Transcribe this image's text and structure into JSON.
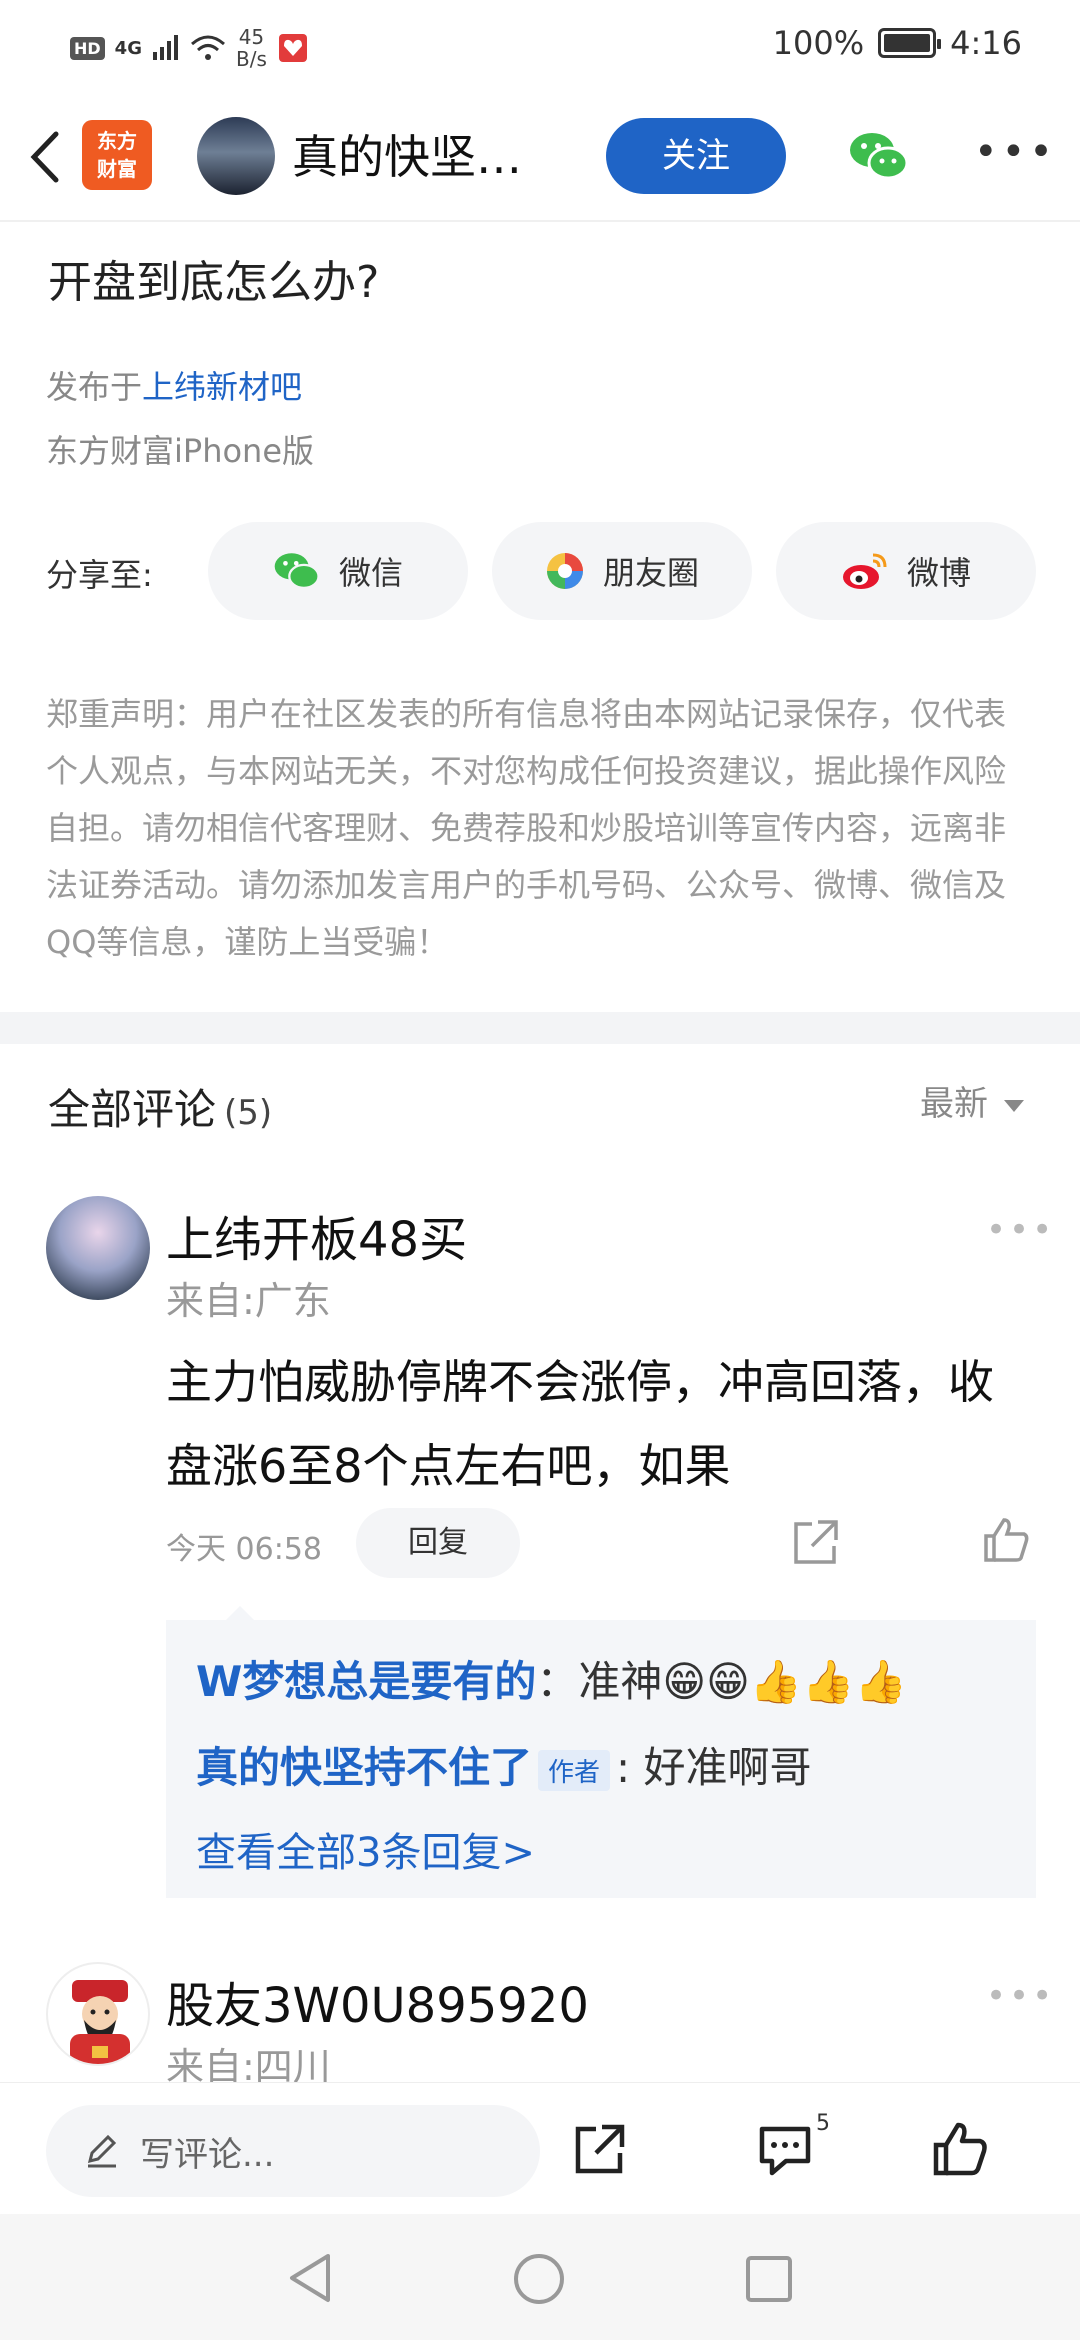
{
  "status_bar": {
    "hd": "HD",
    "signal": "4G",
    "rate_value": "45",
    "rate_unit": "B/s",
    "battery": "100%",
    "time": "4:16"
  },
  "nav": {
    "app_logo_line1": "东方",
    "app_logo_line2": "财富",
    "title": "真的快坚…",
    "follow_label": "关注"
  },
  "post": {
    "title": "开盘到底怎么办?",
    "published_prefix": "发布于",
    "published_forum": "上纬新材吧",
    "source": "东方财富iPhone版"
  },
  "share": {
    "label": "分享至:",
    "wechat": "微信",
    "moments": "朋友圈",
    "weibo": "微博"
  },
  "disclaimer": "郑重声明：用户在社区发表的所有信息将由本网站记录保存，仅代表个人观点，与本网站无关，不对您构成任何投资建议，据此操作风险自担。请勿相信代客理财、免费荐股和炒股培训等宣传内容，远离非法证券活动。请勿添加发言用户的手机号码、公众号、微博、微信及QQ等信息，谨防上当受骗！",
  "comments_header": {
    "title": "全部评论",
    "count": "(5)",
    "sort": "最新"
  },
  "comments": [
    {
      "username": "上纬开板48买",
      "location": "来自:广东",
      "text": "主力怕威胁停牌不会涨停，冲高回落，收盘涨6至8个点左右吧，如果",
      "time": "今天 06:58",
      "reply_label": "回复",
      "replies": [
        {
          "name": "W梦想总是要有的",
          "text": "：准神😁😁👍👍👍"
        },
        {
          "name": "真的快坚持不住了",
          "tag": "作者",
          "text": ": 好准啊哥"
        }
      ],
      "more_replies": "查看全部3条回复>"
    },
    {
      "username": "股友3W0U895920",
      "location": "来自:四川"
    }
  ],
  "bottom_bar": {
    "write_placeholder": "写评论...",
    "comment_count": "5"
  },
  "colors": {
    "accent": "#1f64c6",
    "brand_orange": "#ef5b22",
    "wechat_green": "#3ebd4e"
  }
}
